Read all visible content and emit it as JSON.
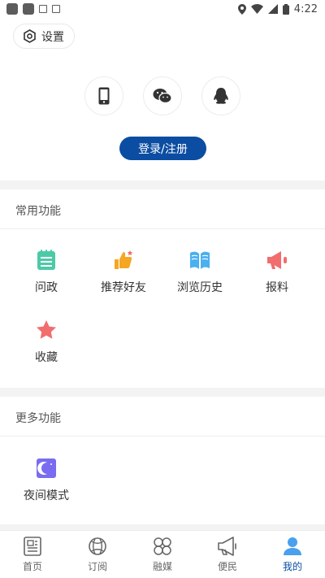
{
  "status_bar": {
    "time": "4:22"
  },
  "header": {
    "settings_label": "设置"
  },
  "login": {
    "methods": [
      "phone-icon",
      "wechat-icon",
      "qq-icon"
    ],
    "button_label": "登录/注册"
  },
  "common_functions": {
    "title": "常用功能",
    "items": [
      {
        "label": "问政",
        "icon": "notepad-icon"
      },
      {
        "label": "推荐好友",
        "icon": "thumbs-up-icon"
      },
      {
        "label": "浏览历史",
        "icon": "book-icon"
      },
      {
        "label": "报料",
        "icon": "megaphone-icon"
      },
      {
        "label": "收藏",
        "icon": "star-icon"
      }
    ]
  },
  "more_functions": {
    "title": "更多功能",
    "items": [
      {
        "label": "夜间模式",
        "icon": "moon-icon"
      }
    ]
  },
  "bottom_nav": {
    "items": [
      {
        "label": "首页",
        "icon": "news-icon"
      },
      {
        "label": "订阅",
        "icon": "subscribe-icon"
      },
      {
        "label": "融媒",
        "icon": "media-icon"
      },
      {
        "label": "便民",
        "icon": "megaphone-outline-icon"
      },
      {
        "label": "我的",
        "icon": "person-icon",
        "active": true
      }
    ]
  },
  "colors": {
    "accent": "#0b4da2",
    "band": "#f3f3f3"
  }
}
